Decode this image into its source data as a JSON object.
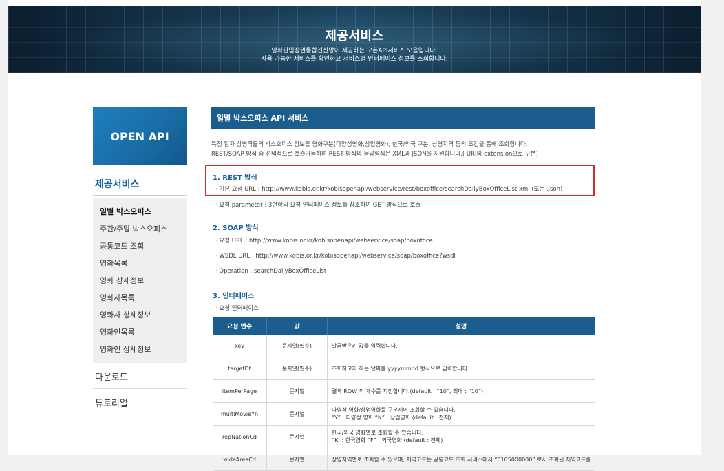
{
  "banner": {
    "title": "제공서비스",
    "line1": "영화관입장권통합전산망이 제공하는 오픈API서비스 모음입니다.",
    "line2": "사용 가능한 서비스를 확인하고 서비스별 인터페이스 정보를 조회합니다."
  },
  "sidebar": {
    "hero": "OPEN API",
    "section_title": "제공서비스",
    "items": [
      {
        "label": "일별 박스오피스"
      },
      {
        "label": "주간/주말 박스오피스"
      },
      {
        "label": "공통코드 조회"
      },
      {
        "label": "영화목록"
      },
      {
        "label": "영화 상세정보"
      },
      {
        "label": "영화사목록"
      },
      {
        "label": "영화사 상세정보"
      },
      {
        "label": "영화인목록"
      },
      {
        "label": "영화인 상세정보"
      }
    ],
    "download": "다운로드",
    "tutorial": "튜토리얼"
  },
  "content": {
    "title": "일별 박스오피스 API 서비스",
    "intro1": "특정 일자 상영작들의 박스오피스 정보를 영화구분(다양성영화,상업영화), 한국/외국 구분, 상영지역 등의 조건을 통해 조회합니다.",
    "intro2": "REST/SOAP 방식 중 선택적으로 호출가능하며 REST 방식의 응답형식은 XML과 JSON을 지원합니다.( URI의 extension으로 구분)",
    "rest": {
      "heading": "1. REST 방식",
      "url": "기본 요청 URL : http://www.kobis.or.kr/kobisopenapi/webservice/rest/boxoffice/searchDailyBoxOfficeList.xml (또는 .json)",
      "param": "요청 parameter : 3번항의 요청 인터페이스 정보를 참조하여 GET 방식으로 호출"
    },
    "soap": {
      "heading": "2. SOAP 방식",
      "url": "요청 URL : http://www.kobis.or.kr/kobisopenapi/webservice/soap/boxoffice",
      "wsdl": "WSDL URL : http://www.kobis.or.kr/kobisopenapi/webservice/soap/boxoffice?wsdl",
      "op": "Operation : searchDailyBoxOfficeList"
    },
    "iface": {
      "heading": "3. 인터페이스",
      "sub": "요청 인터페이스"
    },
    "table": {
      "headers": [
        "요청 변수",
        "값",
        "설명"
      ],
      "rows": [
        {
          "name": "key",
          "value": "문자열(필수)",
          "desc1": "발급받은키 값을 입력합니다.",
          "desc2": ""
        },
        {
          "name": "targetDt",
          "value": "문자열(필수)",
          "desc1": "조회하고자 하는 날짜를 yyyymmdd 형식으로 입력합니다.",
          "desc2": ""
        },
        {
          "name": "itemPerPage",
          "value": "문자열",
          "desc1": "결과 ROW 의 개수를 지정합니다.(default : “10”, 최대 : “10”)",
          "desc2": ""
        },
        {
          "name": "multiMovieYn",
          "value": "문자열",
          "desc1": "다양성 영화/상업영화를 구분지어 조회할 수 있습니다.",
          "desc2": "“Y” : 다양성 영화 “N” : 상업영화 (default : 전체)"
        },
        {
          "name": "repNationCd",
          "value": "문자열",
          "desc1": "한국/외국 영화별로 조회할 수 있습니다.",
          "desc2": "“K: : 한국영화 “F” : 외국영화 (default : 전체)"
        },
        {
          "name": "wideAreaCd",
          "value": "문자열",
          "desc1": "상영지역별로 조회할 수 있으며, 지역코드는 공통코드 조회 서비스에서 “0105000000” 로서 조회된 지역코드를",
          "desc2": ""
        }
      ]
    }
  }
}
